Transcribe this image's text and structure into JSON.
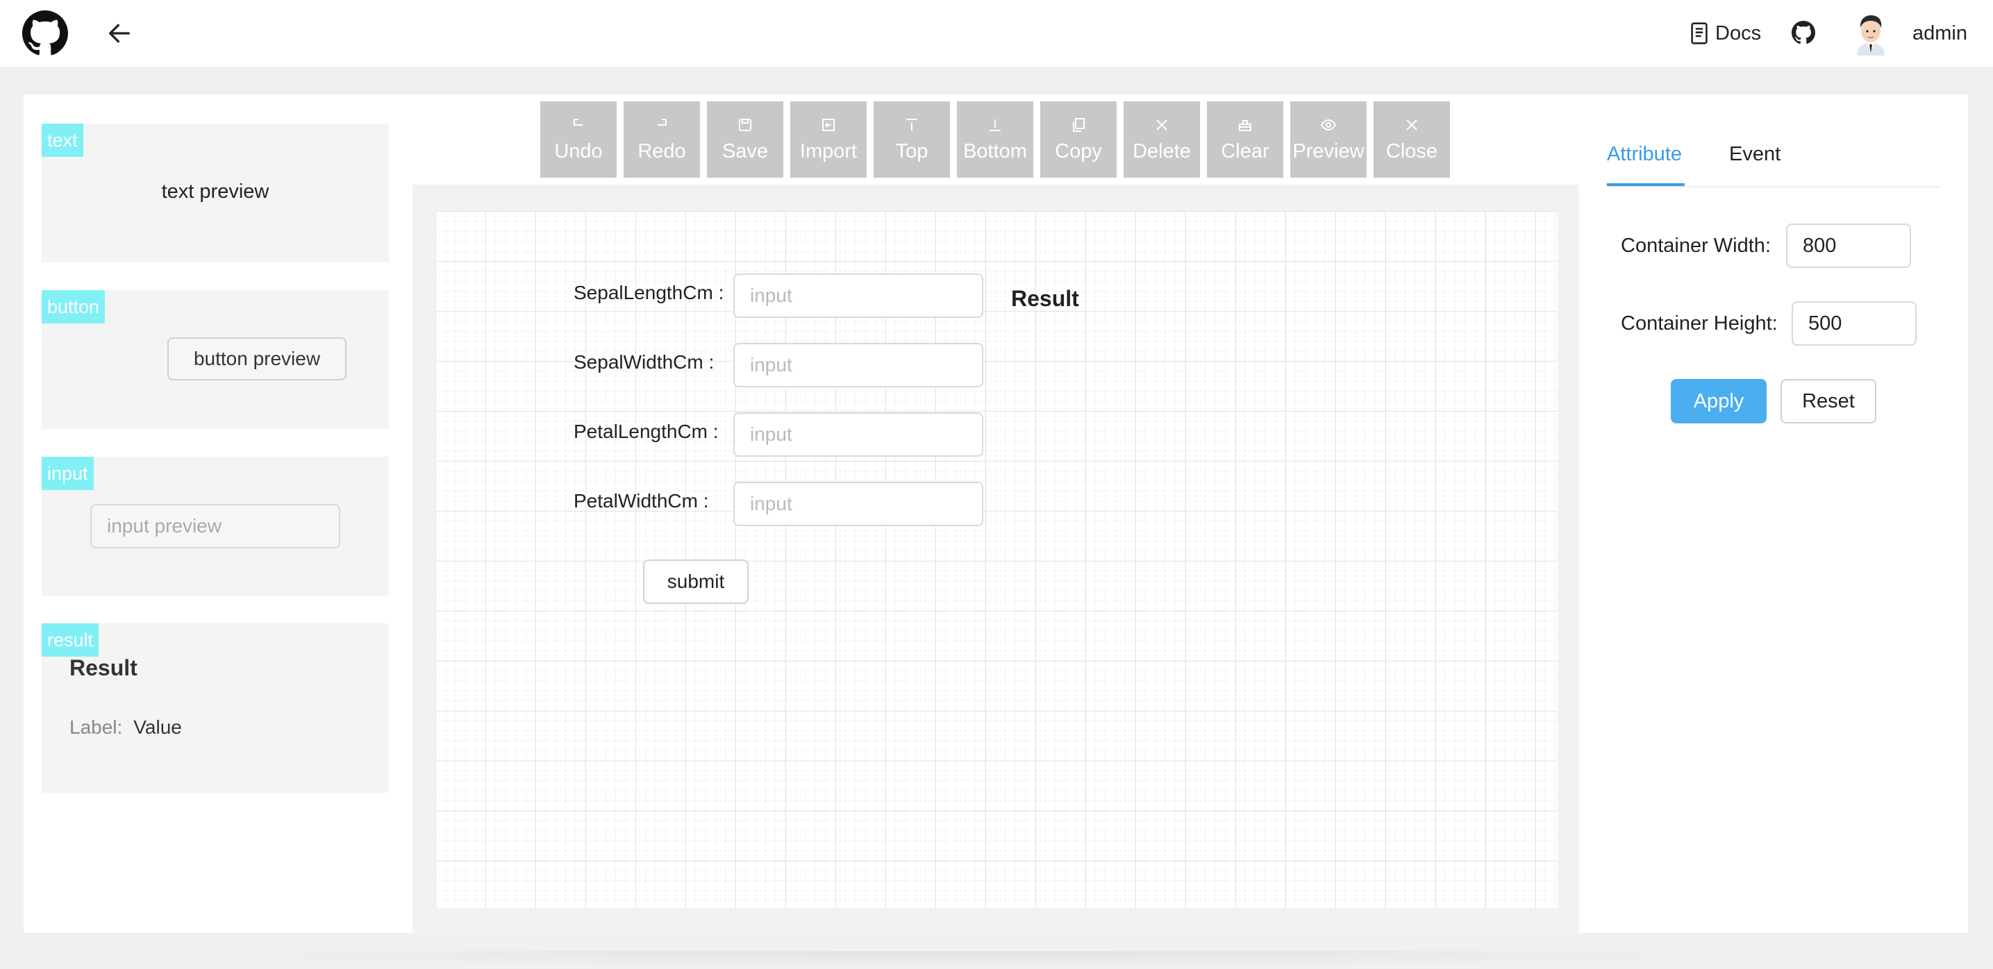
{
  "header": {
    "docs_label": "Docs",
    "user_name": "admin",
    "icons": {
      "logo": "github-logo-icon",
      "back": "arrow-left-icon",
      "docs": "document-icon",
      "github": "github-icon",
      "avatar": "user-avatar"
    }
  },
  "palette": {
    "items": [
      {
        "tag": "text",
        "preview": "text preview"
      },
      {
        "tag": "button",
        "preview": "button preview"
      },
      {
        "tag": "input",
        "preview": "input preview"
      },
      {
        "tag": "result",
        "title": "Result",
        "label": "Label",
        "value": "Value"
      }
    ],
    "tag_color": "#81f0f6"
  },
  "toolbar": {
    "buttons": [
      {
        "label": "Undo",
        "icon": "undo-icon"
      },
      {
        "label": "Redo",
        "icon": "redo-icon"
      },
      {
        "label": "Save",
        "icon": "save-icon"
      },
      {
        "label": "Import",
        "icon": "import-icon"
      },
      {
        "label": "Top",
        "icon": "align-top-icon"
      },
      {
        "label": "Bottom",
        "icon": "align-bottom-icon"
      },
      {
        "label": "Copy",
        "icon": "copy-icon"
      },
      {
        "label": "Delete",
        "icon": "delete-icon"
      },
      {
        "label": "Clear",
        "icon": "clear-icon"
      },
      {
        "label": "Preview",
        "icon": "eye-icon"
      },
      {
        "label": "Close",
        "icon": "close-icon"
      }
    ]
  },
  "canvas": {
    "fields": [
      {
        "label": "SepalLengthCm :",
        "placeholder": "input"
      },
      {
        "label": "SepalWidthCm :",
        "placeholder": "input"
      },
      {
        "label": "PetalLengthCm :",
        "placeholder": "input"
      },
      {
        "label": "PetalWidthCm :",
        "placeholder": "input"
      }
    ],
    "result_title": "Result",
    "submit_label": "submit"
  },
  "attributes": {
    "tabs": [
      "Attribute",
      "Event"
    ],
    "active_tab": "Attribute",
    "width_label": "Container Width",
    "width_value": "800",
    "height_label": "Container Height",
    "height_value": "500",
    "apply_label": "Apply",
    "reset_label": "Reset",
    "accent": "#4aaef0"
  }
}
